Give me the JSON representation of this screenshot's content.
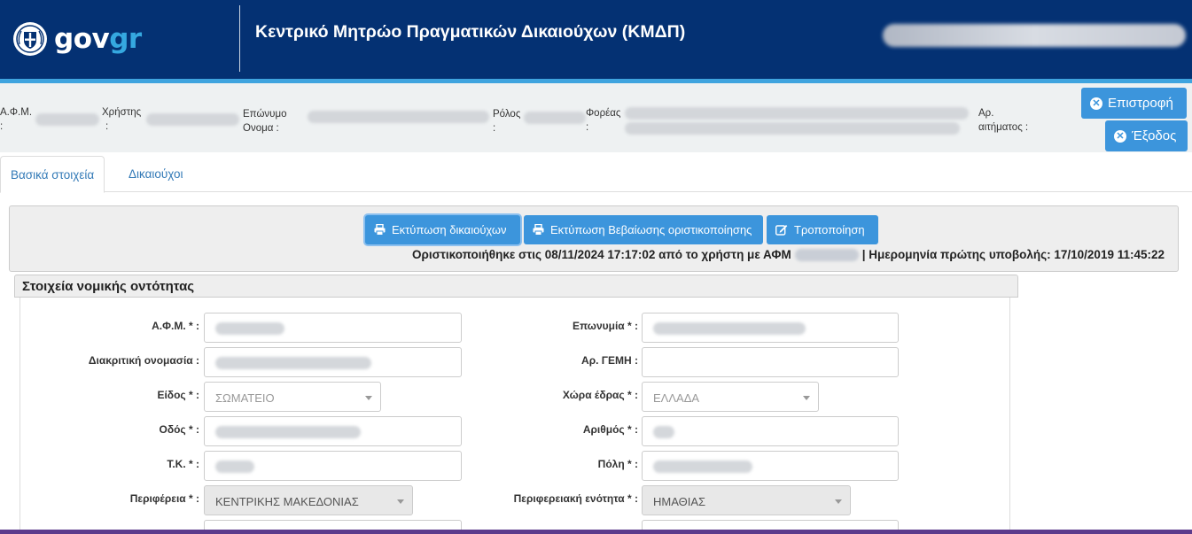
{
  "header": {
    "logo_gov": "gov",
    "logo_gr": "gr",
    "title": "Κεντρικό Μητρώο Πραγματικών Δικαιούχων (ΚΜΔΠ)"
  },
  "infobar": {
    "afm_label_1": "Α.Φ.Μ.",
    "afm_label_2": ":",
    "user_label_1": "Χρήστης",
    "user_label_2": ":",
    "name_label_1": "Επώνυμο",
    "name_label_2": "Ονομα :",
    "role_label_1": "Ρόλος",
    "role_label_2": ":",
    "org_label_1": "Φορέας",
    "org_label_2": ":",
    "req_label_1": "Αρ.",
    "req_label_2": "αιτήματος :",
    "back_button": "Επιστροφή",
    "exit_button": "Έξοδος"
  },
  "tabs": [
    {
      "label": "Βασικά στοιχεία",
      "active": true
    },
    {
      "label": "Δικαιούχοι",
      "active": false
    }
  ],
  "actions": {
    "print_beneficiaries": "Εκτύπωση δικαιούχων",
    "print_certificate": "Εκτύπωση Βεβαίωσης οριστικοποίησης",
    "modify": "Τροποποίηση",
    "status_prefix": "Οριστικοποιήθηκε στις 08/11/2024 17:17:02 από το χρήστη με ΑΦΜ",
    "status_suffix": "| Ημερομηνία πρώτης υποβολής: 17/10/2019 11:45:22"
  },
  "section": {
    "title": "Στοιχεία νομικής οντότητας"
  },
  "form": {
    "afm_label": "Α.Φ.Μ. * :",
    "eponymia_label": "Επωνυμία * :",
    "diakritiki_label": "Διακριτική ονομασία :",
    "gemi_label": "Αρ. ΓΕΜΗ :",
    "eidos_label": "Είδος * :",
    "eidos_value": "ΣΩΜΑΤΕΙΟ",
    "xora_label": "Χώρα έδρας * :",
    "xora_value": "ΕΛΛΑΔΑ",
    "odos_label": "Οδός * :",
    "arithmos_label": "Αριθμός * :",
    "tk_label": "Τ.Κ. * :",
    "poli_label": "Πόλη * :",
    "perifereia_label": "Περιφέρεια * :",
    "perifereia_value": "ΚΕΝΤΡΙΚΗΣ ΜΑΚΕΔΟΝΙΑΣ",
    "enotita_label": "Περιφερειακή ενότητα * :",
    "enotita_value": "ΗΜΑΘΙΑΣ"
  },
  "colors": {
    "header_bg": "#043173",
    "accent_stripe": "#3fa4df",
    "button_blue": "#3c95dc",
    "link_blue": "#337ab7"
  }
}
